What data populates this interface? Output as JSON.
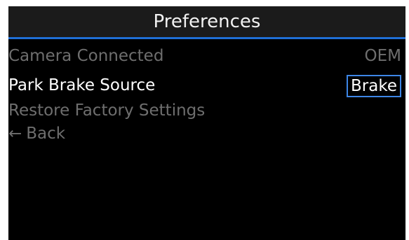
{
  "screen": {
    "title": "Preferences",
    "accent_color": "#1f6fd6",
    "items": [
      {
        "label": "Camera Connected",
        "value": "OEM",
        "state": "disabled"
      },
      {
        "label": "Park Brake Source",
        "value": "Brake",
        "state": "selected"
      },
      {
        "label": "Restore Factory Settings",
        "state": "disabled"
      }
    ],
    "back": {
      "icon": "left-arrow-icon",
      "glyph": "←",
      "label": "Back"
    }
  }
}
